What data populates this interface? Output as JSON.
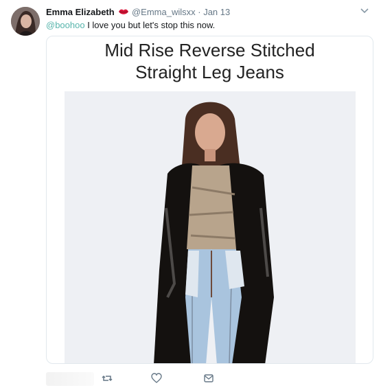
{
  "tweet": {
    "display_name": "Emma Elizabeth",
    "handle": "@Emma_wilsxx",
    "separator": "·",
    "date": "Jan 13",
    "mention": "@boohoo",
    "text": " I love you but let's stop this now."
  },
  "media": {
    "title_line1": "Mid Rise Reverse Stitched",
    "title_line2": "Straight Leg Jeans"
  },
  "icons": {
    "avatar": "user-avatar",
    "lips": "lips-emoji-icon",
    "chevron": "chevron-down-icon",
    "retweet": "retweet-icon",
    "like": "heart-icon",
    "dm": "envelope-icon"
  },
  "colors": {
    "mention": "#55b4ab",
    "meta": "#657786",
    "border": "#e1e8ed"
  }
}
